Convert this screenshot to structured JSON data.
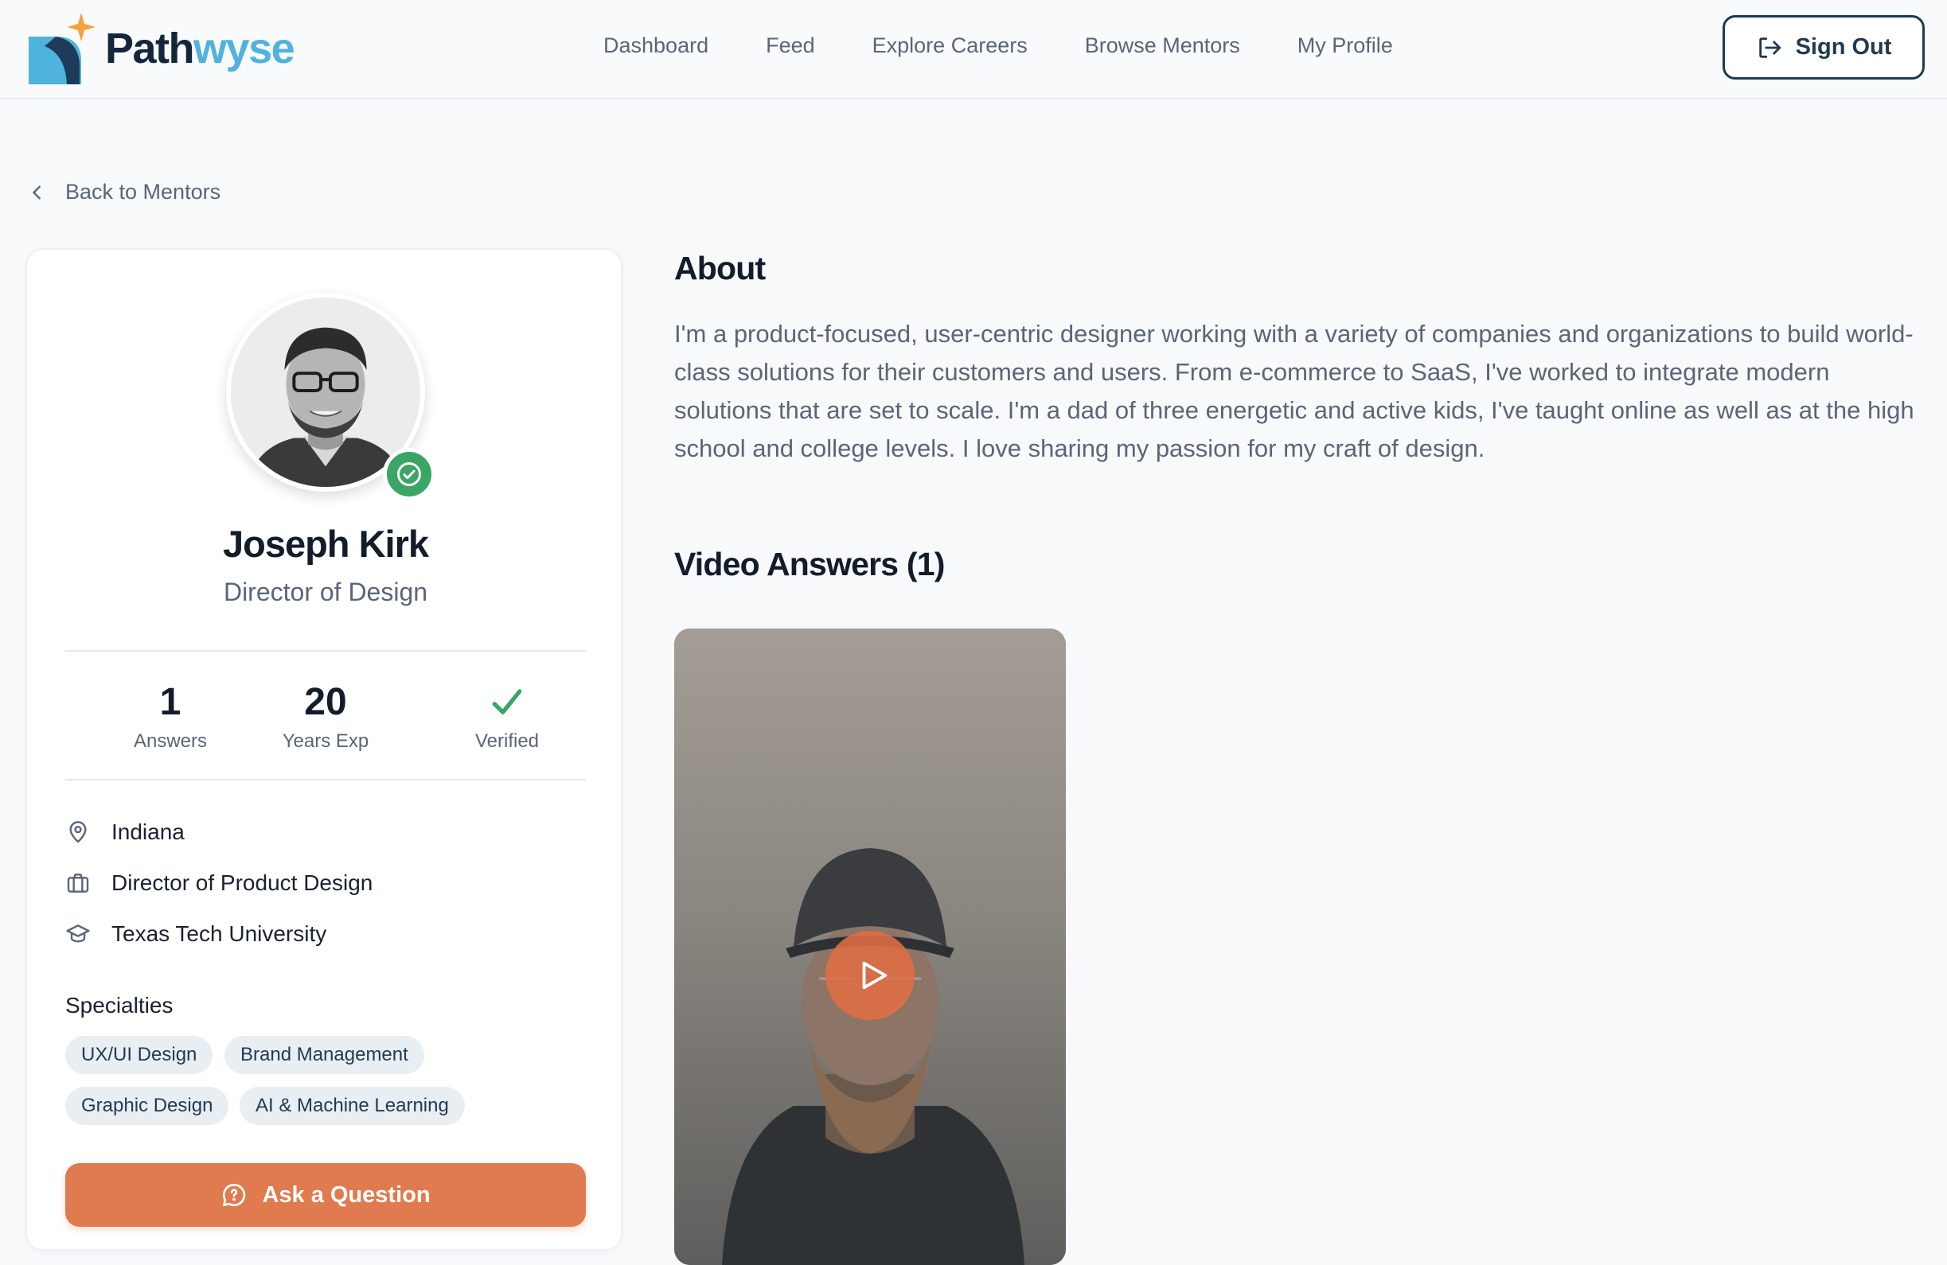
{
  "brand": {
    "name_part1": "Path",
    "name_part2": "wyse"
  },
  "nav": {
    "items": [
      {
        "label": "Dashboard"
      },
      {
        "label": "Feed"
      },
      {
        "label": "Explore Careers"
      },
      {
        "label": "Browse Mentors"
      },
      {
        "label": "My Profile"
      }
    ],
    "sign_out_label": "Sign Out"
  },
  "back_link": {
    "label": "Back to Mentors"
  },
  "profile": {
    "name": "Joseph Kirk",
    "title": "Director of Design",
    "stats": {
      "answers_value": "1",
      "answers_label": "Answers",
      "years_value": "20",
      "years_label": "Years Exp",
      "verified_label": "Verified"
    },
    "location": "Indiana",
    "position": "Director of Product Design",
    "education": "Texas Tech University",
    "specialties_title": "Specialties",
    "specialties": [
      "UX/UI Design",
      "Brand Management",
      "Graphic Design",
      "AI & Machine Learning"
    ],
    "ask_label": "Ask a Question"
  },
  "about": {
    "title": "About",
    "text": "I'm a product-focused, user-centric designer working with a variety of companies and organizations to build world-class solutions for their customers and users. From e-commerce to SaaS, I've worked to integrate modern solutions that are set to scale. I'm a dad of three energetic and active kids, I've taught online as well as at the high school and college levels. I love sharing my passion for my craft of design."
  },
  "videos": {
    "title": "Video Answers (1)"
  },
  "colors": {
    "accent": "#e07a4f",
    "brand_dark": "#14263c",
    "brand_light": "#4fb3dd",
    "verified": "#3aa565",
    "chip_bg": "#e9eef3"
  }
}
